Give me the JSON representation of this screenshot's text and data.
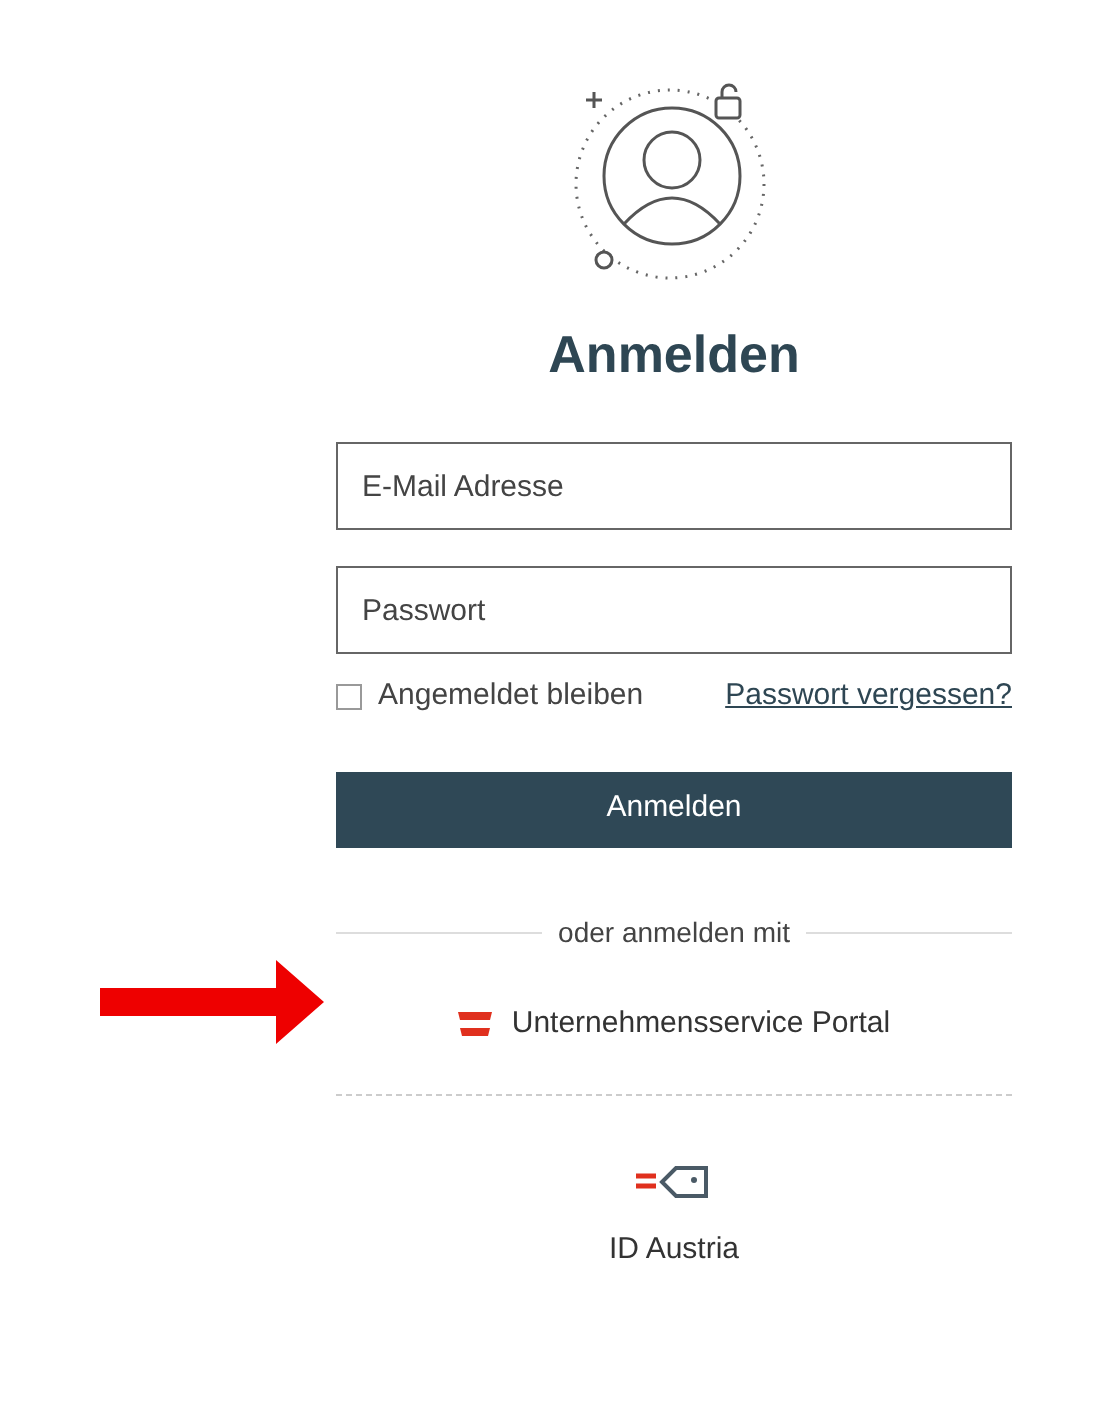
{
  "heading": "Anmelden",
  "email": {
    "placeholder": "E-Mail Adresse"
  },
  "password": {
    "placeholder": "Passwort"
  },
  "remember": {
    "label": "Angemeldet bleiben",
    "checked": false
  },
  "forgot_link": "Passwort vergessen?",
  "submit": "Anmelden",
  "divider": "oder anmelden mit",
  "providers": [
    {
      "kind": "usp",
      "label": "Unternehmensservice Portal"
    },
    {
      "kind": "id_austria",
      "label": "ID Austria"
    }
  ]
}
